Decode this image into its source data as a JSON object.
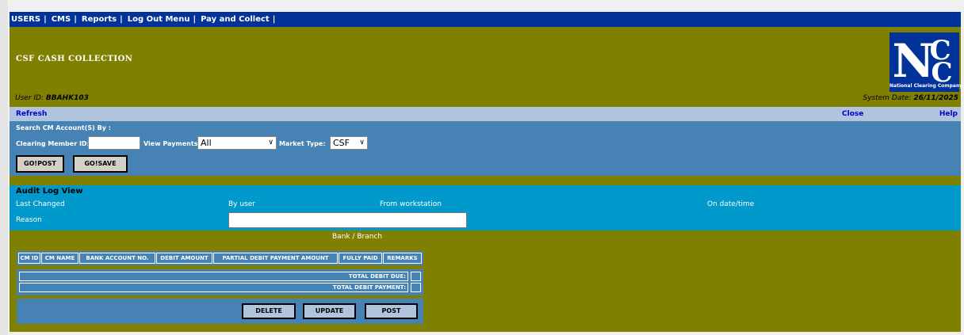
{
  "nav": {
    "items": [
      "USERS",
      "CMS",
      "Reports",
      "Log Out Menu",
      "Pay and Collect"
    ],
    "separator": "|"
  },
  "page": {
    "title": "CSF CASH COLLECTION",
    "user_id_label": "User ID:",
    "user_id": "BBAHK103",
    "system_date_label": "System Date:",
    "system_date": "26/11/2025"
  },
  "logo": {
    "text": "National Clearing Company",
    "letters": "NCC"
  },
  "toolbar": {
    "refresh": "Refresh",
    "close": "Close",
    "help": "Help"
  },
  "search": {
    "heading": "Search CM Account(S) By :",
    "cm_id_label": "Clearing Member ID:",
    "cm_id_value": "",
    "view_payments_label": "View Payments",
    "view_payments_value": "All",
    "market_type_label": "Market Type:",
    "market_type_value": "CSF",
    "gopost": "GO!POST",
    "gosave": "GO!SAVE"
  },
  "audit": {
    "title": "Audit Log View",
    "last_changed": "Last Changed",
    "by_user": "By user",
    "from_workstation": "From workstation",
    "on_date_time": "On date/time",
    "reason": "Reason",
    "reason_value": ""
  },
  "bank_branch": "Bank / Branch",
  "table": {
    "columns": [
      "CM ID",
      "CM NAME",
      "BANK ACCOUNT NO.",
      "DEBIT AMOUNT",
      "PARTIAL DEBIT PAYMENT AMOUNT",
      "FULLY PAID",
      "REMARKS"
    ]
  },
  "totals": {
    "total_debit_due": "TOTAL DEBIT DUE:",
    "total_debit_payment": "TOTAL DEBIT PAYMENT:"
  },
  "actions": {
    "delete": "DELETE",
    "update": "UPDATE",
    "post": "POST"
  },
  "colors": {
    "nav_bg": "#003399",
    "main_bg": "#808000",
    "toolbar_bg": "#b0c4de",
    "search_bg": "#4682b4",
    "audit_bg": "#0099cc"
  }
}
